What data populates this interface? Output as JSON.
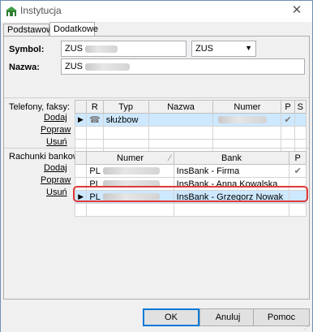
{
  "window": {
    "title": "Instytucja",
    "close_symbol": "✕"
  },
  "tabs": [
    {
      "label": "Podstawowe"
    },
    {
      "label": "Dodatkowe"
    }
  ],
  "form": {
    "symbol_label": "Symbol:",
    "symbol_value": "ZUS",
    "symbol_combo_value": "ZUS",
    "name_label": "Nazwa:",
    "name_value": "ZUS"
  },
  "phones": {
    "section_label": "Telefony, faksy:",
    "actions": {
      "add": "Dodaj",
      "edit": "Popraw",
      "delete": "Usuń"
    },
    "columns": [
      "R",
      "Typ",
      "Nazwa",
      "Numer",
      "P",
      "S"
    ],
    "rows": [
      {
        "type": "służbow",
        "name": "",
        "number": "",
        "p": "✔",
        "s": ""
      }
    ]
  },
  "accounts": {
    "section_label": "Rachunki bankowe:",
    "actions": {
      "add": "Dodaj",
      "edit": "Popraw",
      "delete": "Usuń"
    },
    "columns": [
      "Numer",
      "Bank",
      "P"
    ],
    "sort_indicator": "⁄",
    "rows": [
      {
        "number": "PL",
        "bank": "InsBank - Firma",
        "p": "✔"
      },
      {
        "number": "PL",
        "bank": "InsBank - Anna Kowalska",
        "p": ""
      },
      {
        "number": "PL",
        "bank": "InsBank - Grzegorz Nowak",
        "p": ""
      }
    ]
  },
  "buttons": {
    "ok": "OK",
    "cancel": "Anuluj",
    "help": "Pomoc"
  }
}
